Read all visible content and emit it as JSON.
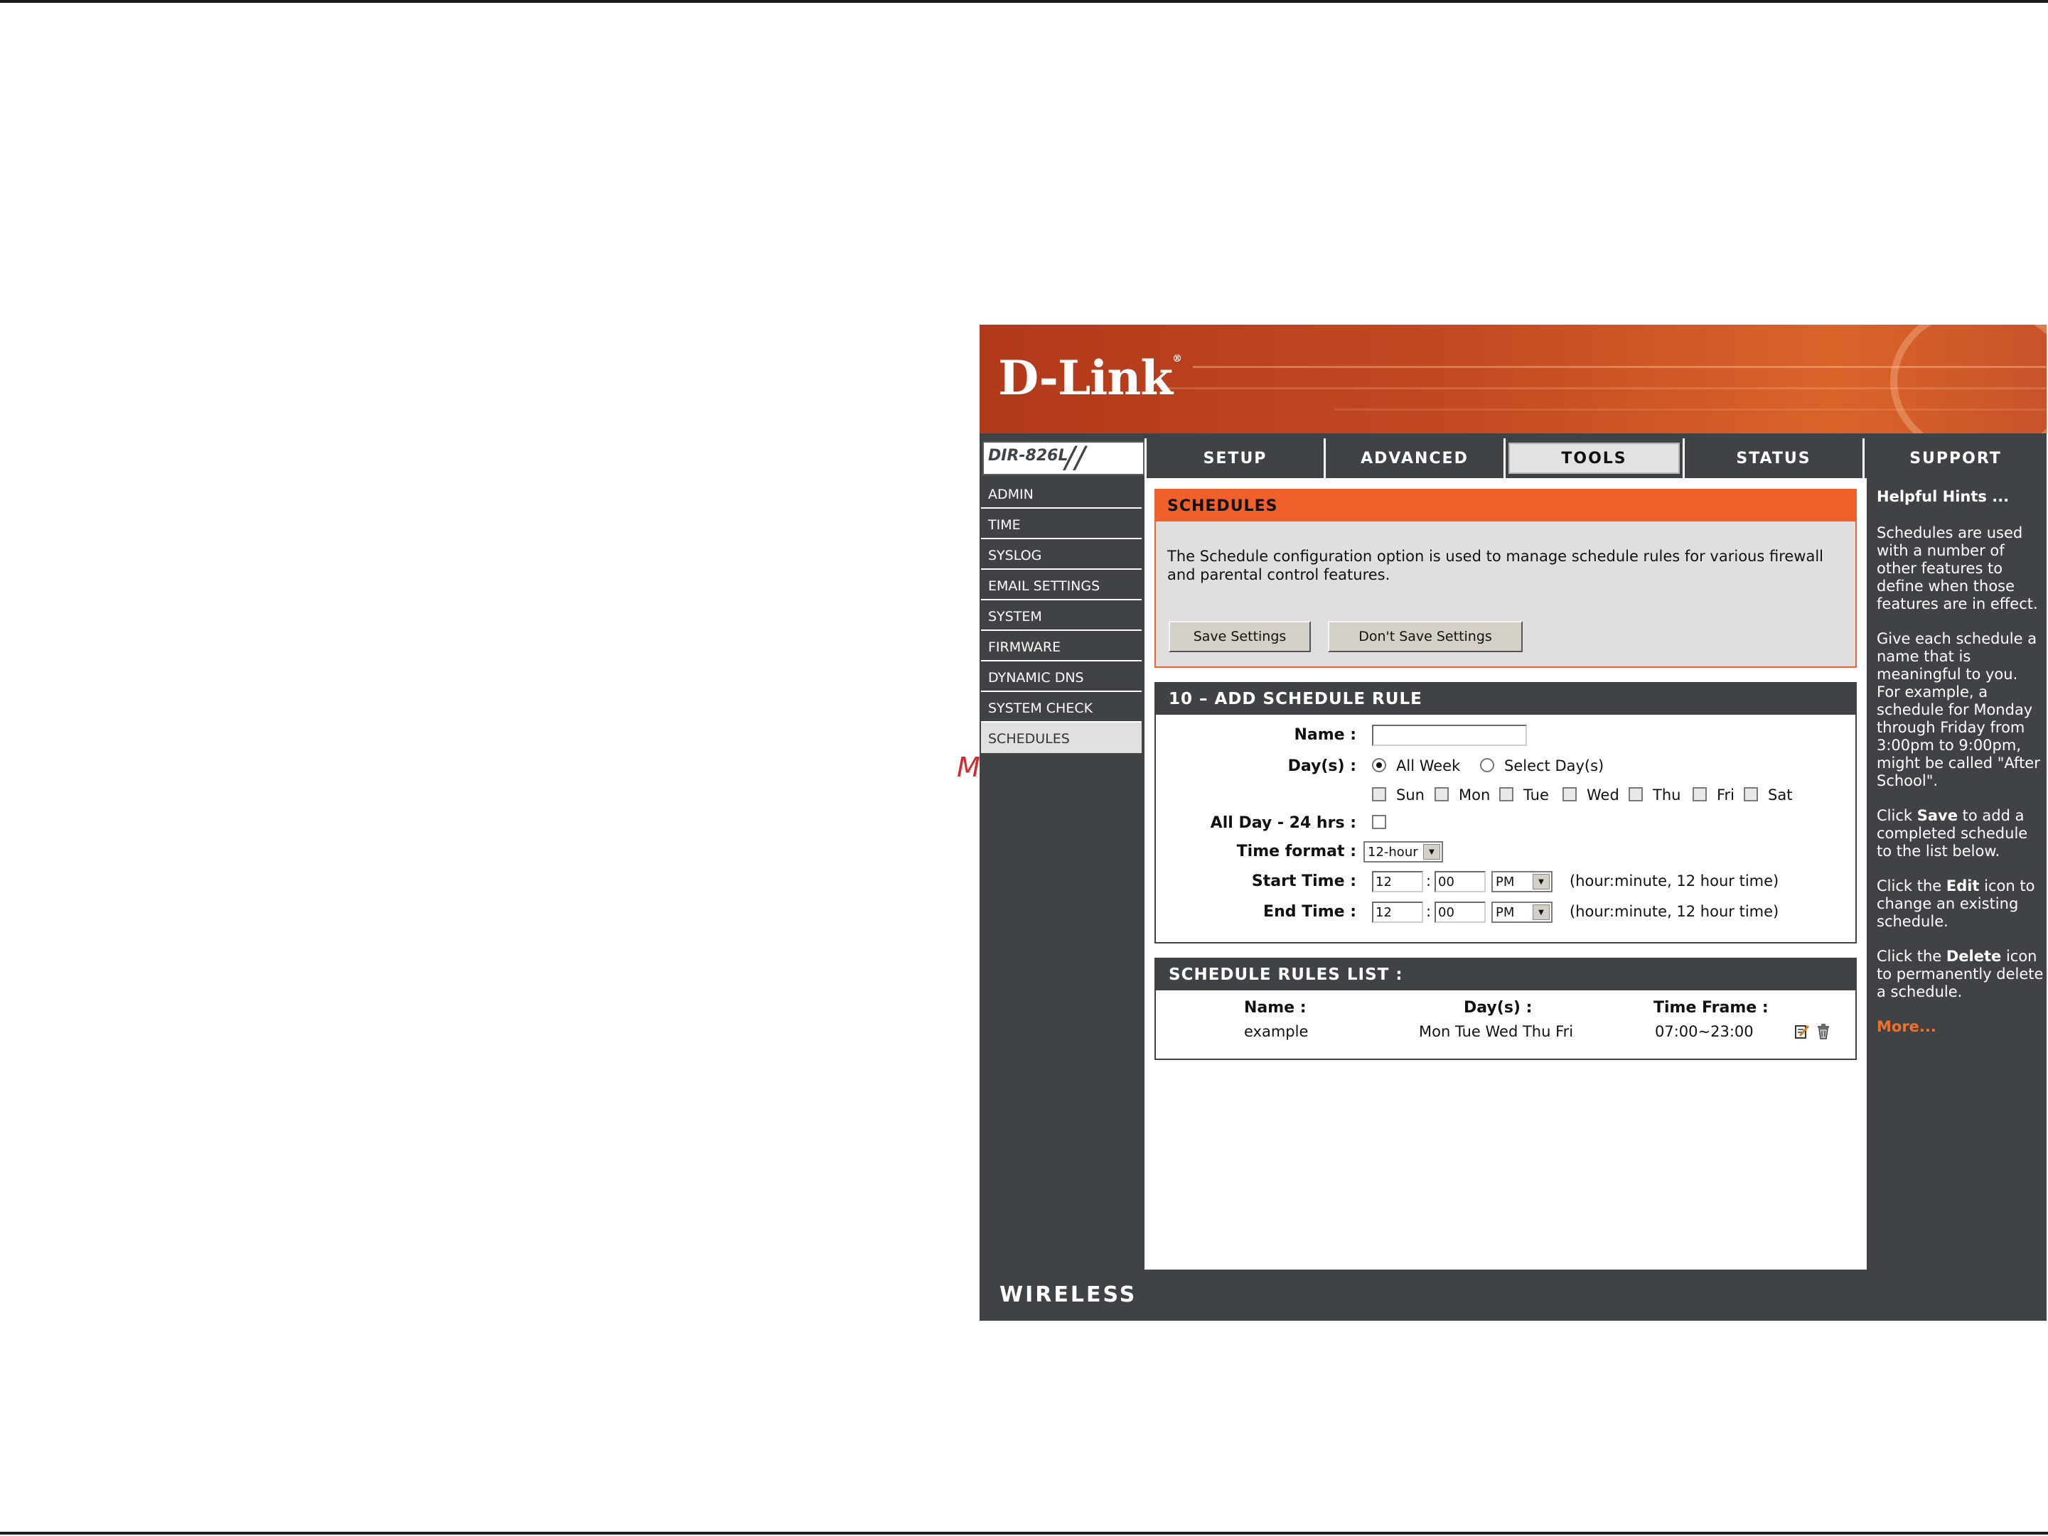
{
  "watermark": "McGrp.Ru",
  "header": {
    "logo": "D-Link",
    "trademark": "®"
  },
  "model": {
    "name": "DIR-826L",
    "slashes": "//"
  },
  "tabs": [
    {
      "label": "SETUP"
    },
    {
      "label": "ADVANCED"
    },
    {
      "label": "TOOLS"
    },
    {
      "label": "STATUS"
    },
    {
      "label": "SUPPORT"
    }
  ],
  "active_tab": "TOOLS",
  "menu": [
    {
      "label": "ADMIN"
    },
    {
      "label": "TIME"
    },
    {
      "label": "SYSLOG"
    },
    {
      "label": "EMAIL SETTINGS"
    },
    {
      "label": "SYSTEM"
    },
    {
      "label": "FIRMWARE"
    },
    {
      "label": "DYNAMIC DNS"
    },
    {
      "label": "SYSTEM CHECK"
    },
    {
      "label": "SCHEDULES"
    }
  ],
  "schedules": {
    "title": "SCHEDULES",
    "description": "The Schedule configuration option is used to manage schedule rules for various firewall and parental control features.",
    "save_label": "Save Settings",
    "dont_save_label": "Don't Save Settings"
  },
  "add_rule": {
    "title": "10 – ADD SCHEDULE RULE",
    "name_label": "Name :",
    "name_value": "",
    "days_label": "Day(s) :",
    "all_week_label": "All Week",
    "select_days_label": "Select Day(s)",
    "days": [
      "Sun",
      "Mon",
      "Tue",
      "Wed",
      "Thu",
      "Fri",
      "Sat"
    ],
    "allday_label": "All Day - 24 hrs :",
    "timeformat_label": "Time format :",
    "timeformat_value": "12-hour",
    "start_label": "Start Time :",
    "start_hour": "12",
    "start_min": "00",
    "start_ampm": "PM",
    "end_label": "End Time :",
    "end_hour": "12",
    "end_min": "00",
    "end_ampm": "PM",
    "colon": ":",
    "hint": "(hour:minute, 12 hour time)"
  },
  "rules_list": {
    "title": "SCHEDULE RULES LIST :",
    "col_name": "Name :",
    "col_days": "Day(s) :",
    "col_time": "Time Frame :",
    "rows": [
      {
        "name": "example",
        "days": "Mon Tue Wed Thu Fri",
        "time": "07:00~23:00"
      }
    ]
  },
  "hints": {
    "title": "Helpful Hints ...",
    "p1": "Schedules are used with a number of other features to define when those features are in effect.",
    "p2": "Give each schedule a name that is meaningful to you. For example, a schedule for Monday through Friday from 3:00pm to 9:00pm, might be called \"After School\".",
    "p3_a": "Click ",
    "p3_b": "Save",
    "p3_c": " to add a completed schedule to the list below.",
    "p4_a": "Click the ",
    "p4_b": "Edit",
    "p4_c": " icon to change an existing schedule.",
    "p5_a": "Click the ",
    "p5_b": "Delete",
    "p5_c": " icon to permanently delete a schedule.",
    "more": "More..."
  },
  "footer": {
    "brand": "WIRELESS"
  },
  "colors": {
    "accent": "#f0602a",
    "panel": "#404345",
    "header": "#c24a22"
  }
}
